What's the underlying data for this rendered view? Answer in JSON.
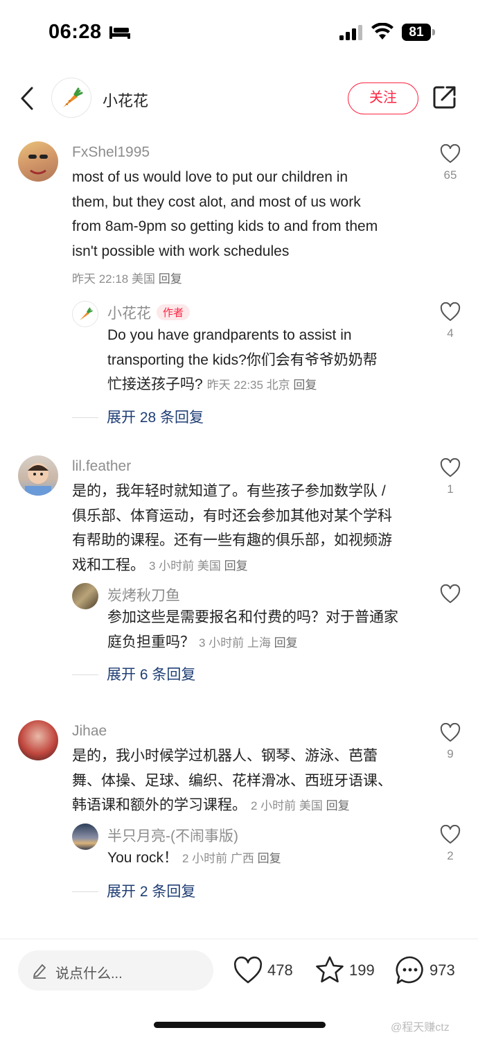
{
  "status_bar": {
    "time": "06:28",
    "battery": "81"
  },
  "header": {
    "author_name": "小花花",
    "follow_label": "关注"
  },
  "comments": [
    {
      "username": "FxShel1995",
      "text_lines": [
        "most of us would love to put our children in",
        "them, but they cost alot, and most of us work",
        "from 8am-9pm so getting kids to and from them",
        "isn't possible with work schedules"
      ],
      "meta": "昨天 22:18 美国",
      "reply_label": "回复",
      "likes": "65",
      "reply": {
        "username": "小花花",
        "author_tag": "作者",
        "text_lines": [
          "Do you have grandparents to assist in",
          "transporting the kids?你们会有爷爷奶奶帮",
          "忙接送孩子吗?"
        ],
        "meta": "昨天 22:35 北京",
        "reply_label": "回复",
        "likes": "4"
      },
      "expand_label": "展开 28 条回复"
    },
    {
      "username": "lil.feather",
      "text_lines": [
        "是的，我年轻时就知道了。有些孩子参加数学队 /",
        "俱乐部、体育运动，有时还会参加其他对某个学科",
        "有帮助的课程。还有一些有趣的俱乐部，如视频游",
        "戏和工程。"
      ],
      "meta": "3 小时前 美国",
      "reply_label": "回复",
      "likes": "1",
      "reply": {
        "username": "炭烤秋刀鱼",
        "text_lines": [
          "参加这些是需要报名和付费的吗？对于普通家",
          "庭负担重吗？"
        ],
        "meta": "3 小时前 上海",
        "reply_label": "回复",
        "likes": ""
      },
      "expand_label": "展开 6 条回复"
    },
    {
      "username": "Jihae",
      "text_lines": [
        "是的，我小时候学过机器人、钢琴、游泳、芭蕾",
        "舞、体操、足球、编织、花样滑冰、西班牙语课、",
        "韩语课和额外的学习课程。"
      ],
      "meta": "2 小时前 美国",
      "reply_label": "回复",
      "likes": "9",
      "reply": {
        "username": "半只月亮-(不闹事版)",
        "text_lines": [
          "You rock！"
        ],
        "meta": "2 小时前 广西",
        "reply_label": "回复",
        "likes": "2"
      },
      "expand_label": "展开 2 条回复"
    }
  ],
  "bottom_bar": {
    "input_placeholder": "说点什么...",
    "likes": "478",
    "favorites": "199",
    "comments": "973"
  },
  "watermark": "@程天赚ctz",
  "colors": {
    "accent": "#ff2442",
    "expand_link": "#1f3e75",
    "muted": "#8d8d8d"
  },
  "icons": [
    "bed-icon",
    "signal-icon",
    "wifi-icon",
    "back-icon",
    "carrot-icon",
    "share-icon",
    "heart-icon",
    "pen-icon",
    "star-icon",
    "comment-bubble-icon"
  ]
}
